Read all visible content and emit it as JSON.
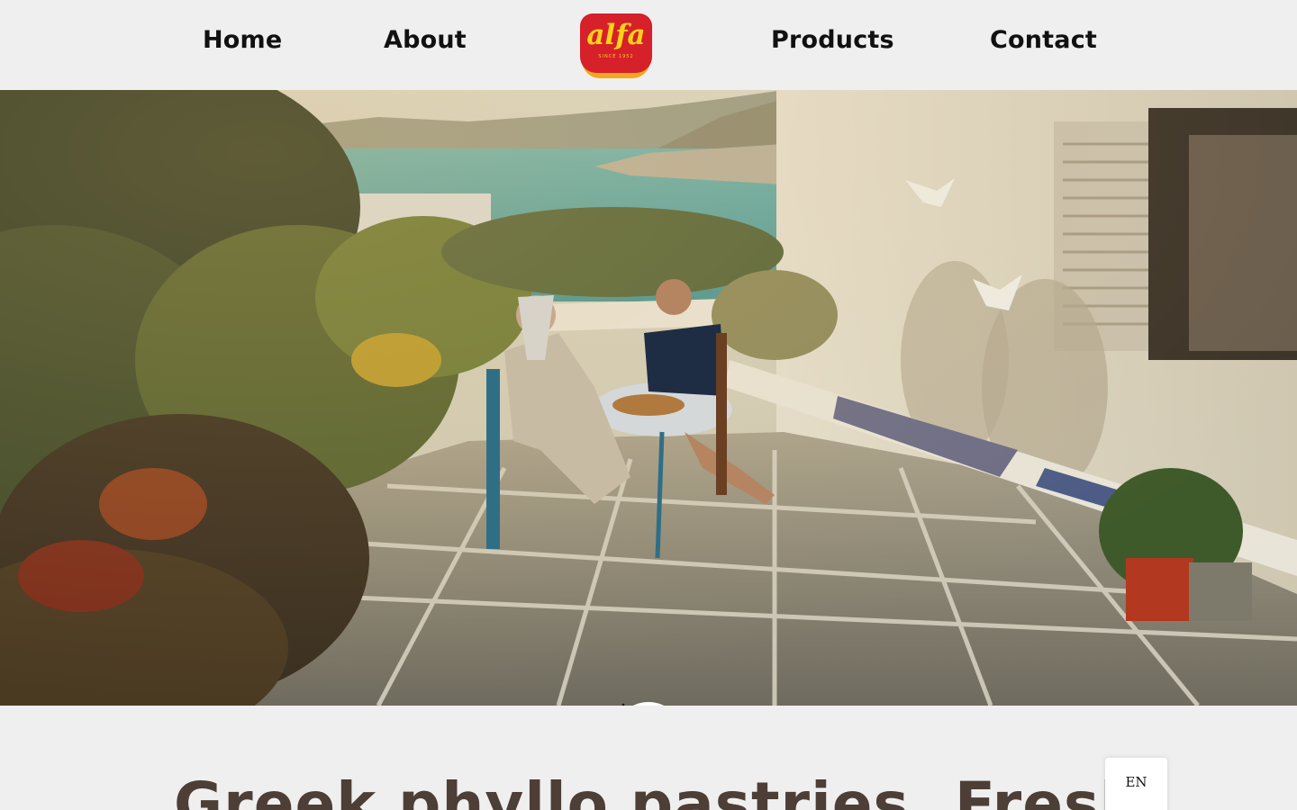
{
  "nav": {
    "home": "Home",
    "about": "About",
    "products": "Products",
    "contact": "Contact"
  },
  "logo": {
    "text": "alfa",
    "tagline": "SINCE 1952"
  },
  "hero": {
    "image_alt": "Two men sharing pastries at a table on a Greek island terrace overlooking the sea",
    "scroll_icon": "arrow-down-icon"
  },
  "headline": "Greek phyllo pastries. Fresh",
  "language": "EN",
  "colors": {
    "brand_red": "#d6202a",
    "brand_yellow": "#ffd21a",
    "headline": "#4d3e36",
    "background": "#efefef"
  }
}
